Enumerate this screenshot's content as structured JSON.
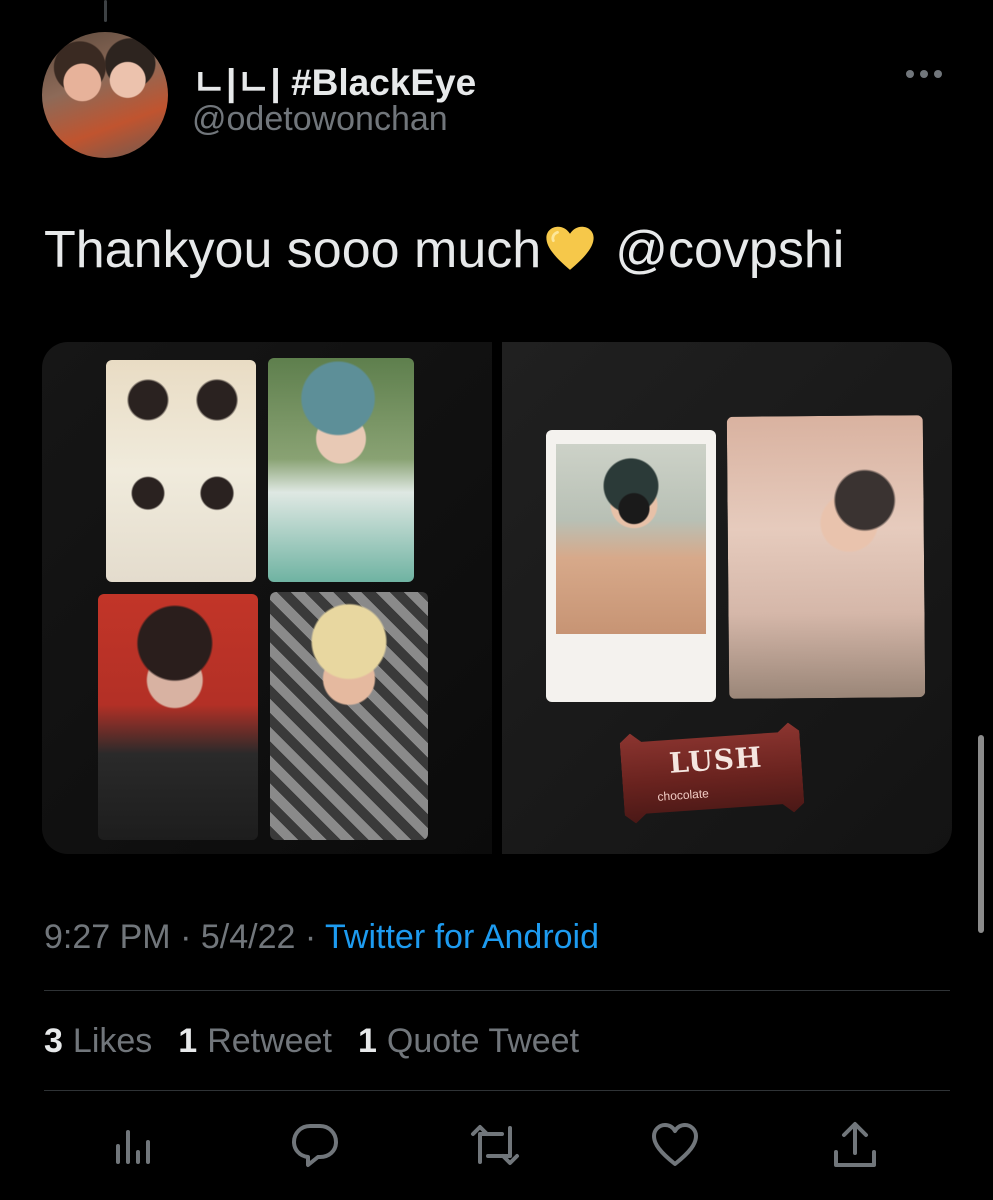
{
  "tweet": {
    "display_name": "ㄴ|ㄴ| #BlackEye",
    "handle": "@odetowonchan",
    "text": "Thankyou sooo much",
    "emoji": "yellow-heart",
    "mention": "@covpshi",
    "time": "9:27 PM",
    "date": "5/4/22",
    "source": "Twitter for Android",
    "separator": "·"
  },
  "stats": {
    "likes_count": "3",
    "likes_label": "Likes",
    "retweets_count": "1",
    "retweets_label": "Retweet",
    "quotes_count": "1",
    "quotes_label": "Quote Tweet"
  },
  "media": {
    "candy_text": "LUSH",
    "candy_subtext": "chocolate"
  },
  "actions": [
    "analytics-icon",
    "reply-icon",
    "retweet-icon",
    "like-icon",
    "share-icon"
  ],
  "colors": {
    "background": "#000000",
    "text": "#e7e9ea",
    "muted": "#71767b",
    "link": "#1d9bf0",
    "divider": "#2f3336"
  }
}
